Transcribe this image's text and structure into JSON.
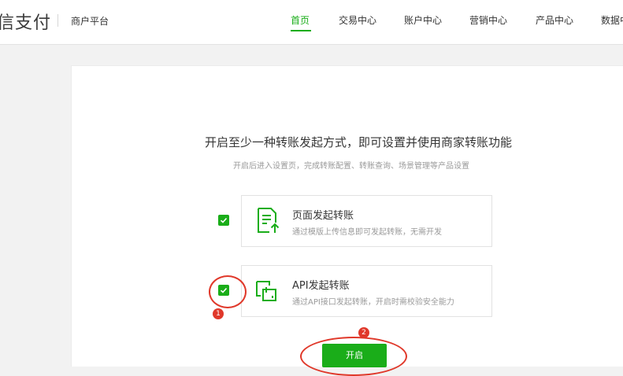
{
  "header": {
    "logo_text": "信支付",
    "platform_label": "商户平台",
    "nav": [
      {
        "label": "首页",
        "active": true
      },
      {
        "label": "交易中心",
        "active": false
      },
      {
        "label": "账户中心",
        "active": false
      },
      {
        "label": "营销中心",
        "active": false
      },
      {
        "label": "产品中心",
        "active": false
      },
      {
        "label": "数据中",
        "active": false
      }
    ]
  },
  "main": {
    "heading": "开启至少一种转账发起方式，即可设置并使用商家转账功能",
    "subheading": "开启后进入设置页，完成转账配置、转账查询、场景管理等产品设置",
    "options": [
      {
        "title": "页面发起转账",
        "description": "通过模版上传信息即可发起转账，无需开发",
        "checked": true,
        "icon": "document-upload-icon"
      },
      {
        "title": "API发起转账",
        "description": "通过API接口发起转账，开启时需校验安全能力",
        "checked": true,
        "icon": "api-link-icon"
      }
    ],
    "open_button": "开启"
  },
  "annotations": {
    "badge_1": "1",
    "badge_2": "2",
    "color": "#e0382a"
  },
  "colors": {
    "accent": "#1aad19",
    "annotation": "#e0382a"
  }
}
